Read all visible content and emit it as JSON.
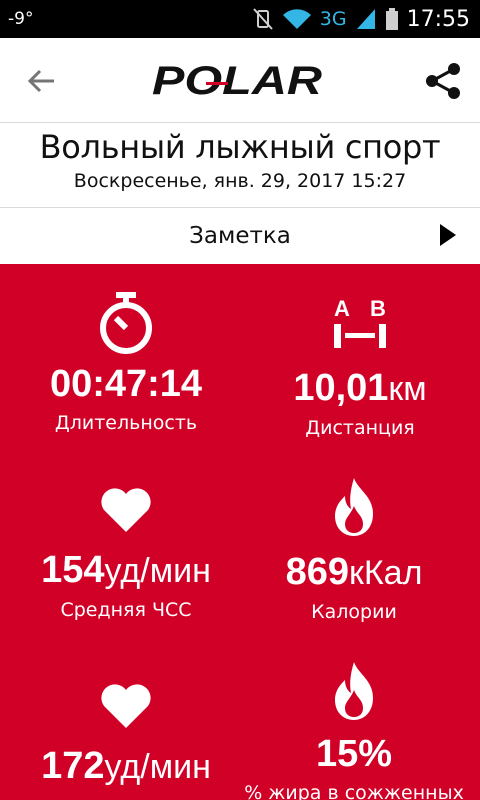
{
  "status_bar": {
    "temperature": "-9°",
    "network": "3G",
    "time": "17:55"
  },
  "app_bar": {
    "logo_text": "POLAR",
    "colors": {
      "brand_red": "#d10027"
    }
  },
  "session": {
    "title": "Вольный лыжный спорт",
    "datetime": "Воскресенье, янв. 29, 2017 15:27"
  },
  "note": {
    "label": "Заметка"
  },
  "stats": [
    {
      "icon": "stopwatch-icon",
      "value": "00:47:14",
      "unit": "",
      "label": "Длительность"
    },
    {
      "icon": "distance-ab-icon",
      "value": "10,01",
      "unit": "км",
      "label": "Дистанция",
      "icon_text_a": "A",
      "icon_text_b": "B"
    },
    {
      "icon": "heart-icon",
      "value": "154",
      "unit": "уд/мин",
      "label": "Средняя ЧСС"
    },
    {
      "icon": "flame-icon",
      "value": "869",
      "unit": "кКал",
      "label": "Калории"
    },
    {
      "icon": "heart-icon",
      "value": "172",
      "unit": "уд/мин",
      "label": ""
    },
    {
      "icon": "flame-icon",
      "value": "15%",
      "unit": "",
      "label": "% жира в сожженных"
    }
  ]
}
